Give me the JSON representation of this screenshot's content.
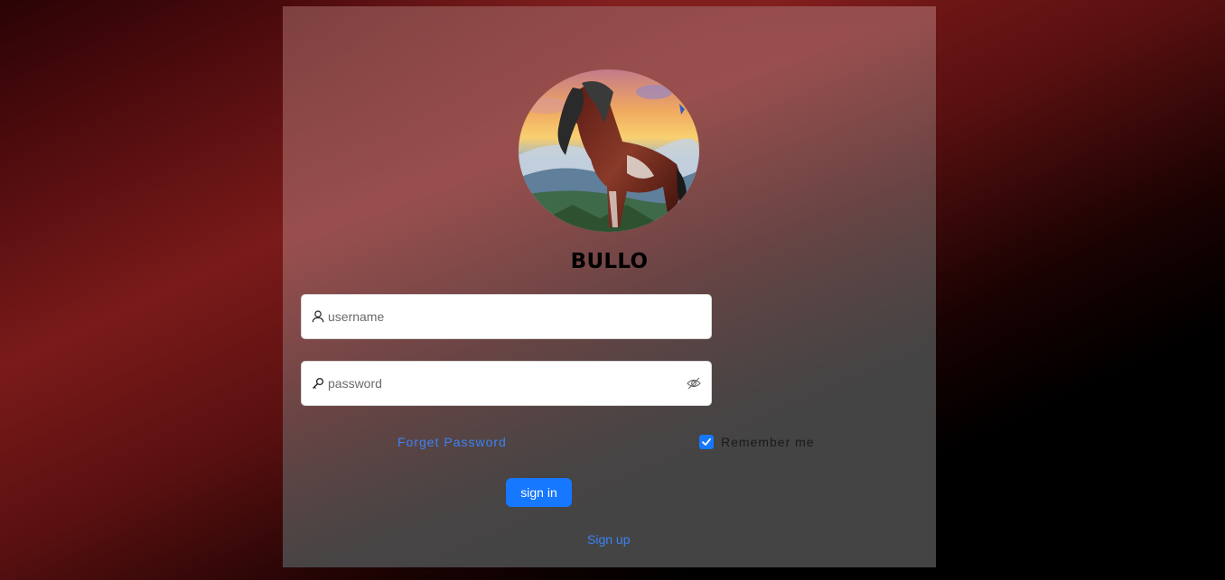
{
  "brand": {
    "name": "BULLO",
    "logo_image": "horse-in-mountain-sunset"
  },
  "login_form": {
    "username": {
      "value": "",
      "placeholder": "username",
      "icon": "user-icon"
    },
    "password": {
      "value": "",
      "placeholder": "password",
      "icon": "key-icon",
      "toggle_icon": "eye-invisible-icon"
    },
    "forget_password_label": "Forget Password",
    "remember_me": {
      "label": "Remember me",
      "checked": true
    },
    "sign_in_label": "sign in",
    "sign_up_label": "Sign up"
  },
  "colors": {
    "primary": "#1677ff",
    "link": "#3b82f6",
    "background_dark_red": "#7a1a1a"
  }
}
